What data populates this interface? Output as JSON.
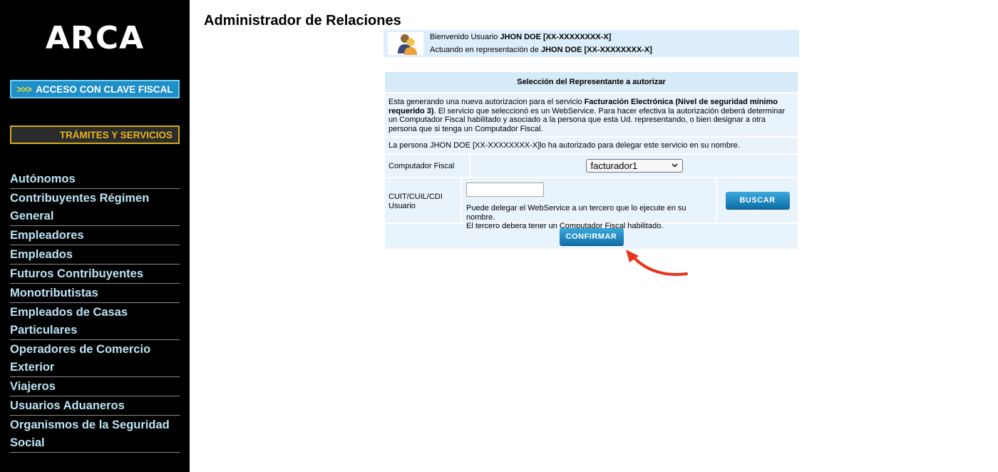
{
  "sidebar": {
    "logo": "ARCA",
    "clave_arrows": ">>>",
    "clave_label": "ACCESO CON CLAVE FISCAL",
    "tramites_label": "TRÁMITES Y SERVICIOS",
    "nav": [
      [
        "Autónomos"
      ],
      [
        "Contribuyentes Régimen",
        "General"
      ],
      [
        "Empleadores"
      ],
      [
        "Empleados"
      ],
      [
        "Futuros Contribuyentes"
      ],
      [
        "Monotributistas"
      ],
      [
        "Empleados de Casas",
        "Particulares"
      ],
      [
        "Operadores de Comercio",
        "Exterior"
      ],
      [
        "Viajeros"
      ],
      [
        "Usuarios Aduaneros"
      ],
      [
        "Organismos de la Seguridad",
        "Social"
      ]
    ]
  },
  "main": {
    "title": "Administrador de Relaciones",
    "welcome": {
      "prefix1": "Bienvenido Usuario ",
      "user1": "JHON DOE [XX-XXXXXXXX-X]",
      "prefix2": "Actuando en representación de ",
      "user2": "JHON DOE [XX-XXXXXXXX-X]"
    },
    "panel": {
      "heading": "Selección del Representante a autorizar",
      "desc_pre": "Esta generando una nueva autorizacion para el servicio ",
      "desc_service": "Facturación Electrónica (Nivel de seguridad mínimo requerido 3)",
      "desc_post": ". El servicio que seleccionó es un WebService. Para hacer efectiva la autorización deberá determinar un Computador Fiscal habilitado y asociado a la persona que esta Ud. representando, o bien designar a otra persona que si tenga un Computador Fiscal.",
      "delegate_line": "La persona JHON DOE [XX-XXXXXXXX-X]lo ha autorizado para delegar este servicio en su nombre.",
      "computador_label": "Computador Fiscal",
      "computador_value": "facturador1",
      "cuit_label": "CUIT/CUIL/CDI Usuario",
      "cuit_value": "",
      "cuit_help1": "Puede delegar el WebService a un tercero que lo ejecute en su nombre.",
      "cuit_help2": "El tercero debera tener un Computador Fiscal habilitado.",
      "buscar_label": "BUSCAR",
      "confirmar_label": "CONFIRMAR"
    }
  },
  "colors": {
    "sidebar_bg": "#000000",
    "nav_text": "#bde4f4",
    "clave_bg": "#1e8fc9",
    "tramites_border": "#d6a91e",
    "panel_bg": "#e8f3fc",
    "button_blue": "#1a86c4",
    "annotation_arrow": "#e8341c"
  },
  "icons": {
    "welcome_avatar": "users-icon",
    "select_chevron": "chevron-down-icon",
    "annotation": "red-curved-arrow-icon"
  }
}
